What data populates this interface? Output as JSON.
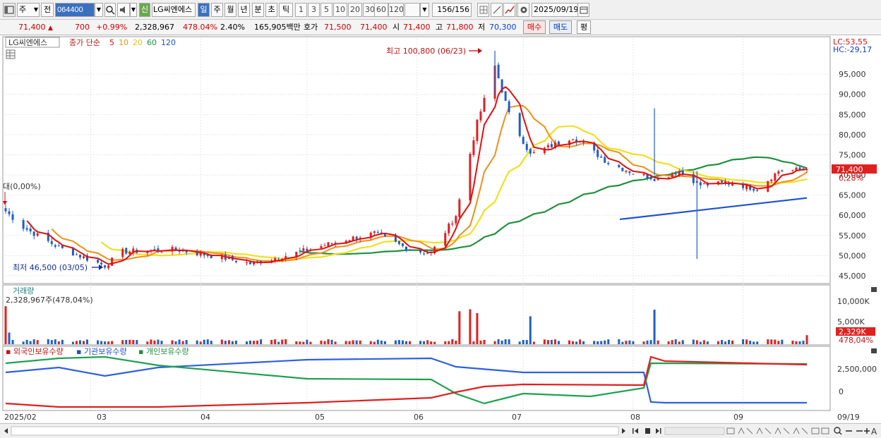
{
  "toolbar": {
    "type_label": "주",
    "prev_label": "전",
    "code": "064400",
    "new_badge": "신",
    "stock_name": "LG씨엔에스",
    "periods": [
      "일",
      "주",
      "월",
      "년",
      "분",
      "초",
      "틱"
    ],
    "period_selected": "일",
    "intervals": [
      "1",
      "3",
      "5",
      "10",
      "20",
      "30",
      "60",
      "120"
    ],
    "count": "156/156",
    "date": "2025/09/19"
  },
  "quote": {
    "price": "71,400",
    "change": "700",
    "change_pct": "+0.99%",
    "volume": "2,328,967",
    "volume_ratio": "478.04%",
    "turnover": "2.40%",
    "amount": "165,905백만",
    "ask_label": "호가",
    "ask1": "71,500",
    "ask2": "71,400",
    "open_label": "시",
    "open": "71,400",
    "high_label": "고",
    "high": "71,800",
    "low_label": "저",
    "low": "70,300",
    "buy_label": "매수",
    "sell_label": "매도",
    "avg_label": "평"
  },
  "legend": {
    "stock": "LG씨엔에스",
    "ma_label": "종가 단순",
    "ma_periods": [
      "5",
      "10",
      "20",
      "60",
      "120"
    ],
    "ma_colors": [
      "#e01010",
      "#f0901a",
      "#f0e020",
      "#209040",
      "#2050d0"
    ]
  },
  "annotations": {
    "high": "최고 100,800 (06/23)",
    "low": "최저 46,500 (03/05)",
    "listing": "대(0,00%)",
    "lc": "LC:53,55",
    "hc": "HC:-29,17",
    "price_tag": "71,400",
    "pct_tag": "0,28%"
  },
  "volume_panel": {
    "title": "거래량",
    "info": "2,328,967주(478,04%)",
    "tag": "2,329K",
    "tag_pct": "478,04%",
    "y_ticks": [
      "10,000K",
      "5,000K"
    ]
  },
  "holdings_panel": {
    "labels": [
      "외국인보유수량",
      "기관보유수량",
      "개인보유수량"
    ],
    "y_ticks": [
      "2,500,000",
      "0"
    ]
  },
  "x_axis": [
    "2025/02",
    "03",
    "04",
    "05",
    "06",
    "07",
    "08",
    "09",
    "09/19"
  ],
  "chart_data": [
    {
      "type": "candlestick",
      "title": "LG씨엔에스",
      "y_ticks": [
        "95,000",
        "90,000",
        "85,000",
        "80,000",
        "75,000",
        "70,000",
        "65,000",
        "60,000",
        "55,000",
        "50,000",
        "45,000"
      ],
      "ylim": [
        43000,
        102000
      ],
      "approx_path": [
        [
          "2025-02-05",
          61000
        ],
        [
          "2025-02-10",
          57000
        ],
        [
          "2025-02-20",
          52000
        ],
        [
          "2025-03-05",
          47500
        ],
        [
          "2025-03-10",
          51000
        ],
        [
          "2025-03-25",
          51500
        ],
        [
          "2025-04-07",
          49500
        ],
        [
          "2025-04-15",
          48000
        ],
        [
          "2025-04-25",
          50000
        ],
        [
          "2025-05-12",
          54000
        ],
        [
          "2025-05-20",
          55500
        ],
        [
          "2025-05-30",
          51500
        ],
        [
          "2025-06-05",
          50500
        ],
        [
          "2025-06-12",
          60000
        ],
        [
          "2025-06-18",
          83000
        ],
        [
          "2025-06-23",
          97000
        ],
        [
          "2025-06-27",
          85000
        ],
        [
          "2025-07-03",
          75000
        ],
        [
          "2025-07-15",
          79500
        ],
        [
          "2025-07-25",
          73000
        ],
        [
          "2025-08-01",
          70500
        ],
        [
          "2025-08-08",
          69000
        ],
        [
          "2025-08-14",
          71000
        ],
        [
          "2025-08-20",
          67500
        ],
        [
          "2025-08-29",
          68000
        ],
        [
          "2025-09-05",
          66500
        ],
        [
          "2025-09-11",
          71000
        ],
        [
          "2025-09-19",
          71400
        ]
      ],
      "high": 100800,
      "low": 46500
    },
    {
      "type": "bar",
      "title": "거래량",
      "approx_spikes": [
        [
          "2025-06-13",
          8500
        ],
        [
          "2025-06-16",
          9000
        ],
        [
          "2025-06-18",
          8000
        ],
        [
          "2025-07-03",
          7200
        ],
        [
          "2025-08-07",
          8900
        ]
      ],
      "last_value_k": 2329
    },
    {
      "type": "line",
      "title": "보유수량",
      "series": [
        {
          "name": "외국인보유수량",
          "color": "#e02020"
        },
        {
          "name": "기관보유수량",
          "color": "#3060e0"
        },
        {
          "name": "개인보유수량",
          "color": "#20a050"
        }
      ]
    }
  ]
}
